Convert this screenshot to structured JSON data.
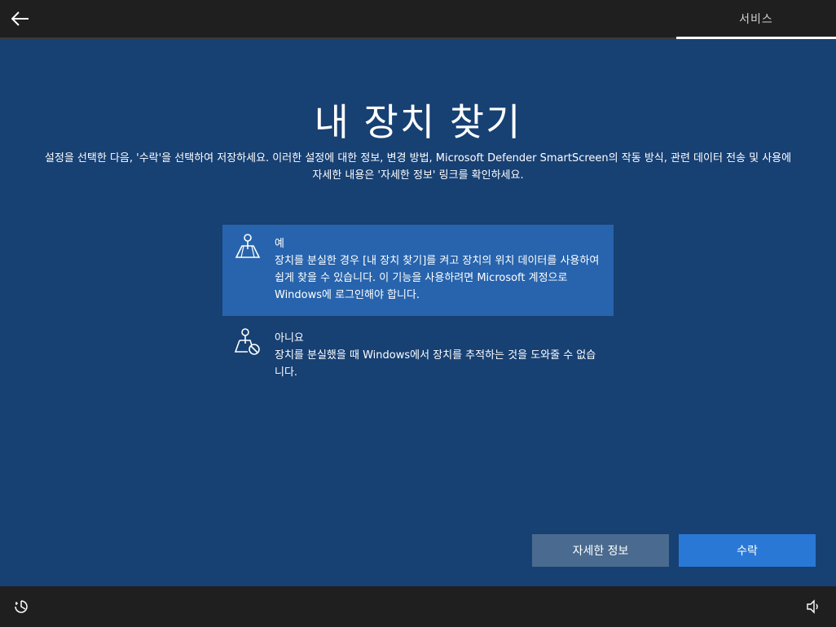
{
  "header": {
    "back_icon": "back-arrow-icon",
    "tab_label": "서비스"
  },
  "main": {
    "title": "내 장치 찾기",
    "description": "설정을 선택한 다음, '수락'을 선택하여 저장하세요. 이러한 설정에 대한 정보, 변경 방법, Microsoft Defender SmartScreen의 작동 방식, 관련 데이터 전송 및 사용에 자세한 내용은 '자세한 정보' 링크를 확인하세요.",
    "options": [
      {
        "title": "예",
        "description": "장치를 분실한 경우 [내 장치 찾기]를 켜고 장치의 위치 데이터를 사용하여 쉽게 찾을 수 있습니다. 이 기능을 사용하려면 Microsoft 계정으로 Windows에 로그인해야 합니다.",
        "icon": "location-map-icon",
        "selected": true
      },
      {
        "title": "아니요",
        "description": "장치를 분실했을 때 Windows에서 장치를 추적하는 것을 도와줄 수 없습니다.",
        "icon": "location-blocked-icon",
        "selected": false
      }
    ]
  },
  "buttons": {
    "more_info": "자세한 정보",
    "accept": "수락"
  },
  "footer": {
    "left_icon": "ease-of-access-icon",
    "right_icon": "volume-icon"
  },
  "colors": {
    "background": "#174073",
    "selected_option": "#2764ad",
    "accept_button": "#2a78d6",
    "secondary_button": "#4a6b8f",
    "bar": "#1f1f1f"
  }
}
